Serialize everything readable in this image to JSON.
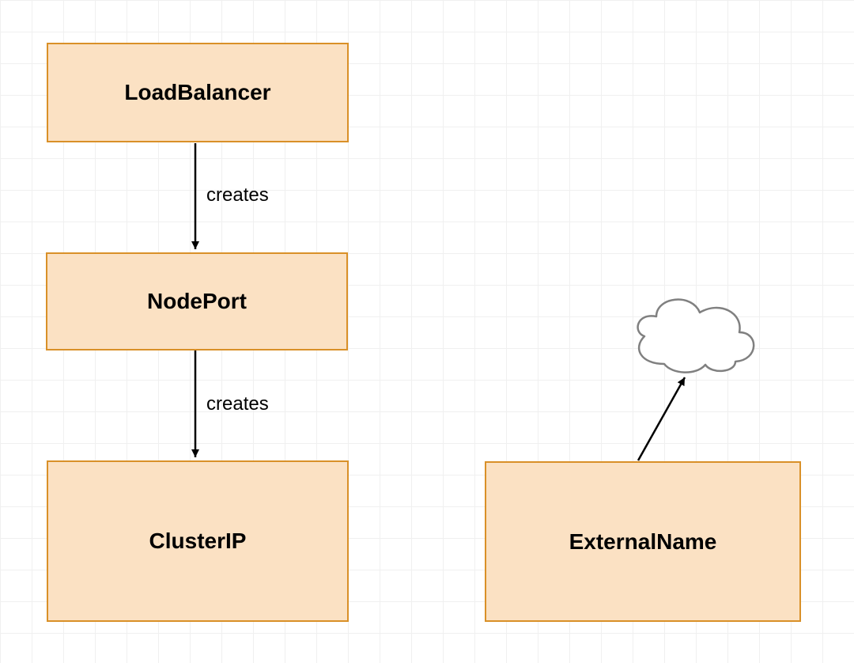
{
  "nodes": {
    "loadbalancer": {
      "label": "LoadBalancer"
    },
    "nodeport": {
      "label": "NodePort"
    },
    "clusterip": {
      "label": "ClusterIP"
    },
    "externalname": {
      "label": "ExternalName"
    }
  },
  "edges": {
    "lb_to_np": {
      "label": "creates"
    },
    "np_to_ci": {
      "label": "creates"
    }
  }
}
